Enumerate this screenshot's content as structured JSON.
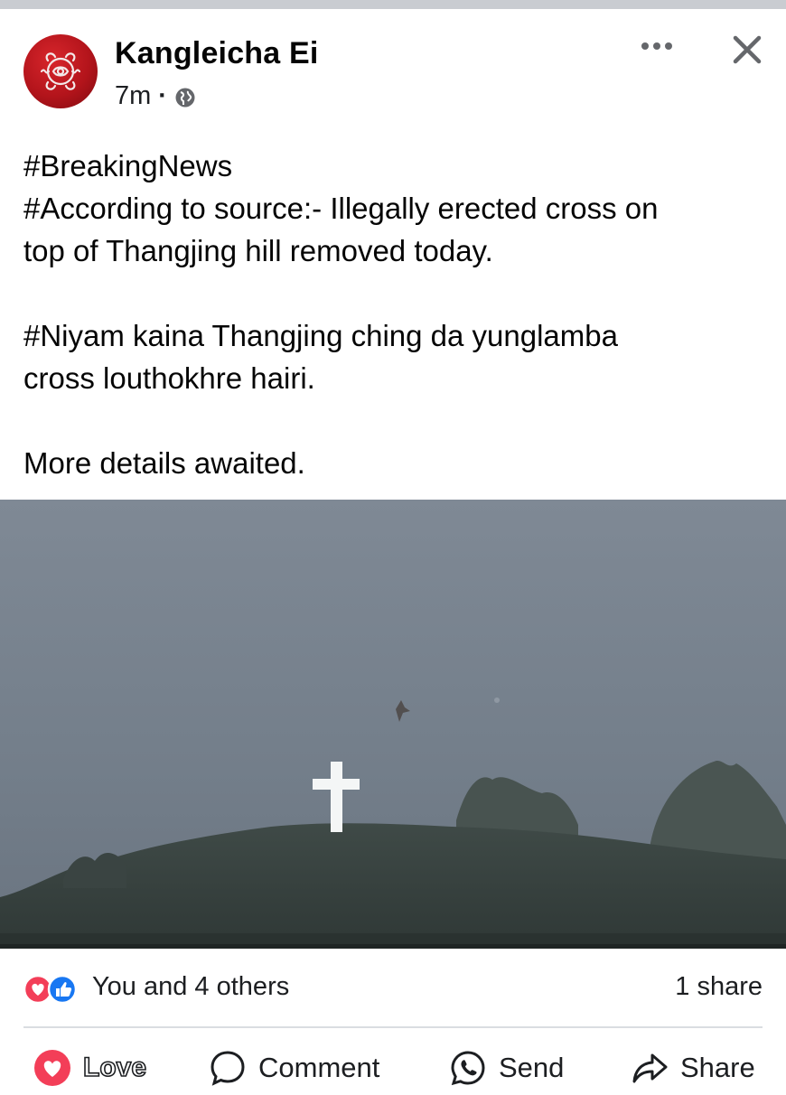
{
  "post": {
    "author": "Kangleicha Ei",
    "time": "7m",
    "separator": "·",
    "privacy_icon": "globe-icon",
    "text_lines": [
      "#BreakingNews",
      "#According to source:- Illegally erected cross on",
      "top of Thangjing hill removed today.",
      "",
      "#Niyam kaina Thangjing ching da yunglamba",
      "cross louthokhre hairi.",
      "",
      "More details awaited."
    ]
  },
  "header_actions": {
    "more_icon": "more-dots-icon",
    "close_icon": "close-icon"
  },
  "reactions": {
    "icons": [
      "love-reaction-icon",
      "like-reaction-icon"
    ],
    "summary": "You and 4 others",
    "shares": "1 share"
  },
  "actions": {
    "love": "Love",
    "comment": "Comment",
    "send": "Send",
    "share": "Share"
  },
  "colors": {
    "love_red": "#f33e58",
    "like_blue": "#1877f2",
    "avatar_red": "#b3141b",
    "text": "#050505",
    "divider": "#dadde1"
  }
}
